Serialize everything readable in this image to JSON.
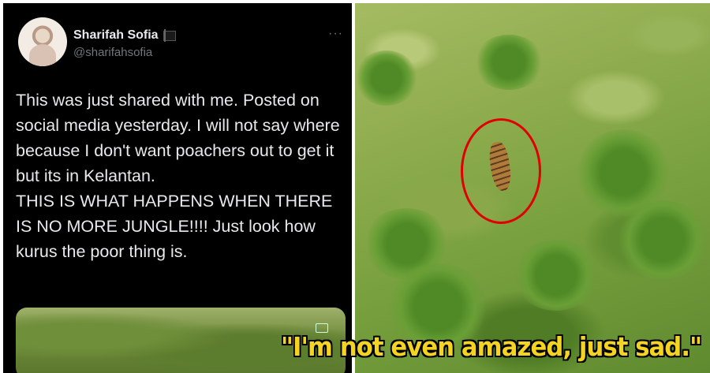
{
  "tweet": {
    "display_name": "Sharifah Sofia",
    "handle": "@sharifahsofia",
    "more_icon": "more-horizontal-icon",
    "flag_icon": "black-flag-icon",
    "text": "This was just shared with me. Posted on social media yesterday. I will not say where because I don't want poachers out to get it but its in Kelantan.\nTHIS IS WHAT HAPPENS WHEN THERE IS NO MORE JUNGLE!!!! Just look how kurus the poor thing is."
  },
  "caption": "\"I'm not even amazed, just sad.\"",
  "colors": {
    "tweet_background": "#000000",
    "highlight_circle": "#e00000",
    "caption_text": "#f4d321"
  }
}
